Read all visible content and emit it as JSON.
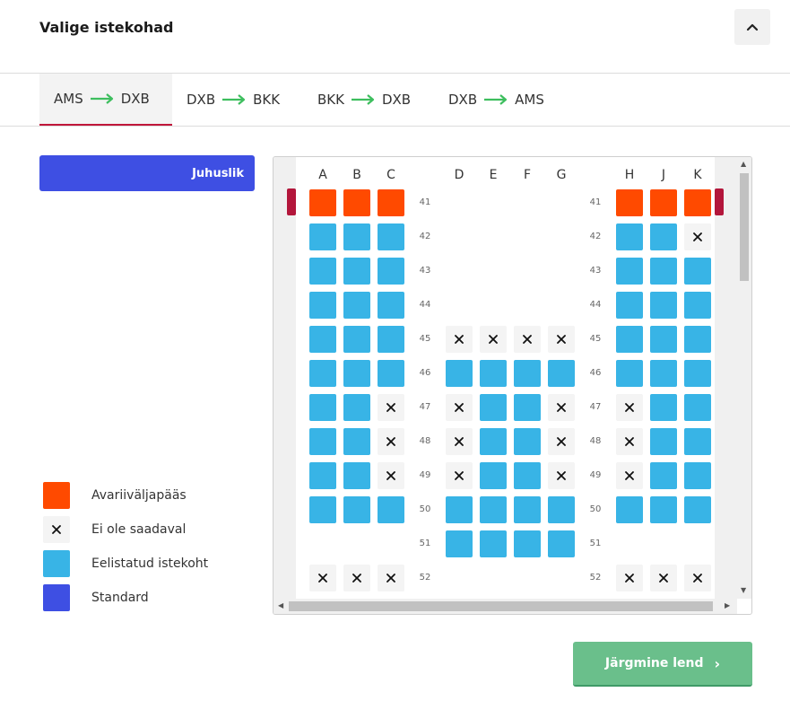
{
  "header": {
    "title": "Valige istekohad"
  },
  "tabs": [
    {
      "from": "AMS",
      "to": "DXB",
      "active": true
    },
    {
      "from": "DXB",
      "to": "BKK",
      "active": false
    },
    {
      "from": "BKK",
      "to": "DXB",
      "active": false
    },
    {
      "from": "DXB",
      "to": "AMS",
      "active": false
    }
  ],
  "random_button": "Juhuslik",
  "legend": [
    {
      "type": "emergency",
      "label": "Avariiväljapääs"
    },
    {
      "type": "unavailable",
      "label": "Ei ole saadaval"
    },
    {
      "type": "preferred",
      "label": "Eelistatud istekoht"
    },
    {
      "type": "standard",
      "label": "Standard"
    }
  ],
  "colors": {
    "emergency": "#ff4a00",
    "preferred": "#38b4e6",
    "standard": "#3e4fe3",
    "unavailable": "#f4f4f4",
    "exit_marker": "#b3163b",
    "next_button": "#6abf8b",
    "tab_arrow": "#3dbe5e"
  },
  "seatmap": {
    "columns": [
      "A",
      "B",
      "C",
      "D",
      "E",
      "F",
      "G",
      "H",
      "J",
      "K"
    ],
    "rows": [
      {
        "num": "41",
        "seats": {
          "A": "emergency",
          "B": "emergency",
          "C": "emergency",
          "H": "emergency",
          "J": "emergency",
          "K": "emergency"
        }
      },
      {
        "num": "42",
        "seats": {
          "A": "preferred",
          "B": "preferred",
          "C": "preferred",
          "H": "preferred",
          "J": "preferred",
          "K": "unavailable"
        }
      },
      {
        "num": "43",
        "seats": {
          "A": "preferred",
          "B": "preferred",
          "C": "preferred",
          "H": "preferred",
          "J": "preferred",
          "K": "preferred"
        }
      },
      {
        "num": "44",
        "seats": {
          "A": "preferred",
          "B": "preferred",
          "C": "preferred",
          "H": "preferred",
          "J": "preferred",
          "K": "preferred"
        }
      },
      {
        "num": "45",
        "seats": {
          "A": "preferred",
          "B": "preferred",
          "C": "preferred",
          "D": "unavailable",
          "E": "unavailable",
          "F": "unavailable",
          "G": "unavailable",
          "H": "preferred",
          "J": "preferred",
          "K": "preferred"
        }
      },
      {
        "num": "46",
        "seats": {
          "A": "preferred",
          "B": "preferred",
          "C": "preferred",
          "D": "preferred",
          "E": "preferred",
          "F": "preferred",
          "G": "preferred",
          "H": "preferred",
          "J": "preferred",
          "K": "preferred"
        }
      },
      {
        "num": "47",
        "seats": {
          "A": "preferred",
          "B": "preferred",
          "C": "unavailable",
          "D": "unavailable",
          "E": "preferred",
          "F": "preferred",
          "G": "unavailable",
          "H": "unavailable",
          "J": "preferred",
          "K": "preferred"
        }
      },
      {
        "num": "48",
        "seats": {
          "A": "preferred",
          "B": "preferred",
          "C": "unavailable",
          "D": "unavailable",
          "E": "preferred",
          "F": "preferred",
          "G": "unavailable",
          "H": "unavailable",
          "J": "preferred",
          "K": "preferred"
        }
      },
      {
        "num": "49",
        "seats": {
          "A": "preferred",
          "B": "preferred",
          "C": "unavailable",
          "D": "unavailable",
          "E": "preferred",
          "F": "preferred",
          "G": "unavailable",
          "H": "unavailable",
          "J": "preferred",
          "K": "preferred"
        }
      },
      {
        "num": "50",
        "seats": {
          "A": "preferred",
          "B": "preferred",
          "C": "preferred",
          "D": "preferred",
          "E": "preferred",
          "F": "preferred",
          "G": "preferred",
          "H": "preferred",
          "J": "preferred",
          "K": "preferred"
        }
      },
      {
        "num": "51",
        "seats": {
          "D": "preferred",
          "E": "preferred",
          "F": "preferred",
          "G": "preferred"
        }
      },
      {
        "num": "52",
        "seats": {
          "A": "unavailable",
          "B": "unavailable",
          "C": "unavailable",
          "H": "unavailable",
          "J": "unavailable",
          "K": "unavailable"
        }
      },
      {
        "num": "",
        "seats": {
          "B": "standard",
          "H": "standard"
        }
      }
    ]
  },
  "next_button": "Järgmine lend"
}
